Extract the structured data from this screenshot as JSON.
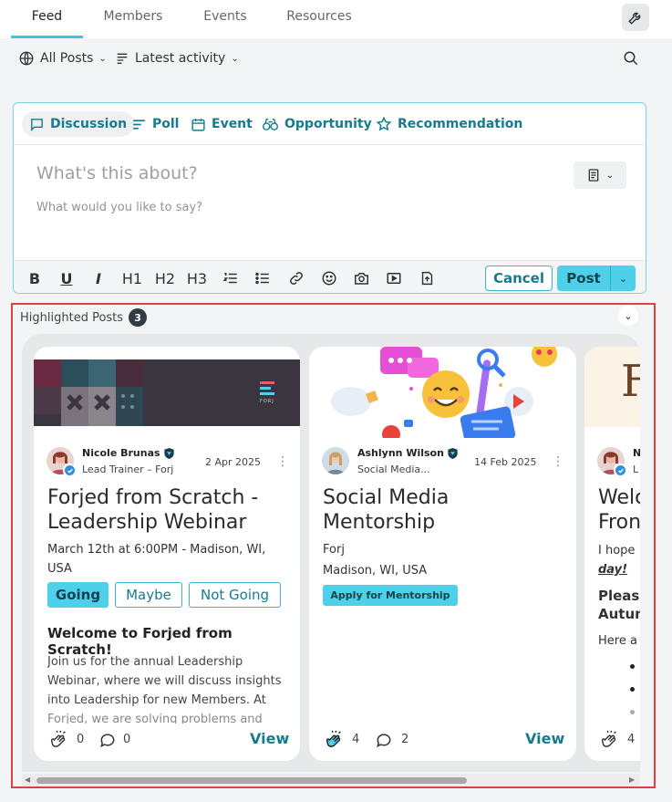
{
  "tabs": [
    {
      "label": "Feed"
    },
    {
      "label": "Members"
    },
    {
      "label": "Events"
    },
    {
      "label": "Resources"
    }
  ],
  "filters": {
    "posts": "All Posts",
    "sort": "Latest activity"
  },
  "composer": {
    "post_types": [
      "Discussion",
      "Poll",
      "Event",
      "Opportunity",
      "Recommendation"
    ],
    "subject_placeholder": "What's this about?",
    "body_placeholder": "What would you like to say?",
    "toolbar": {
      "h1": "H1",
      "h2": "H2",
      "h3": "H3"
    },
    "cancel_label": "Cancel",
    "post_label": "Post"
  },
  "highlighted": {
    "title": "Highlighted Posts",
    "count": "3",
    "cards": [
      {
        "author": "Nicole Brunas",
        "role": "Lead Trainer – Forj",
        "date": "2 Apr 2025",
        "title": "Forjed from Scratch - Leadership Webinar",
        "line1": "March 12th at 6:00PM - Madison, WI,",
        "line2": "USA",
        "rsvp": [
          "Going",
          "Maybe",
          "Not Going"
        ],
        "heading": "Welcome to Forjed from Scratch!",
        "excerpt": [
          "Join us for the annual Leadership",
          "Webinar, where we will discuss insights",
          "into Leadership for new Members. At",
          "Forjed, we are solving problems and"
        ],
        "claps": "0",
        "comments": "0",
        "view": "View",
        "banner_logo": "FORJ"
      },
      {
        "author": "Ashlynn Wilson",
        "role": "Social Media...",
        "date": "14 Feb 2025",
        "title": "Social Media Mentorship",
        "line1": "Forj",
        "line2": "Madison, WI, USA",
        "cta": "Apply for Mentorship",
        "claps": "4",
        "comments": "2",
        "view": "View"
      },
      {
        "author": "N",
        "role": "L",
        "title_l1": "Welc",
        "title_l2": "Fron",
        "t1": "I hope",
        "t2": "day!",
        "t3": "Please",
        "t4": "Autun",
        "t5": "Here a",
        "claps": "4"
      }
    ]
  },
  "colors": {
    "accent": "#4fd0ea",
    "accent_text": "#157c8f",
    "frame": "#d9443f"
  }
}
